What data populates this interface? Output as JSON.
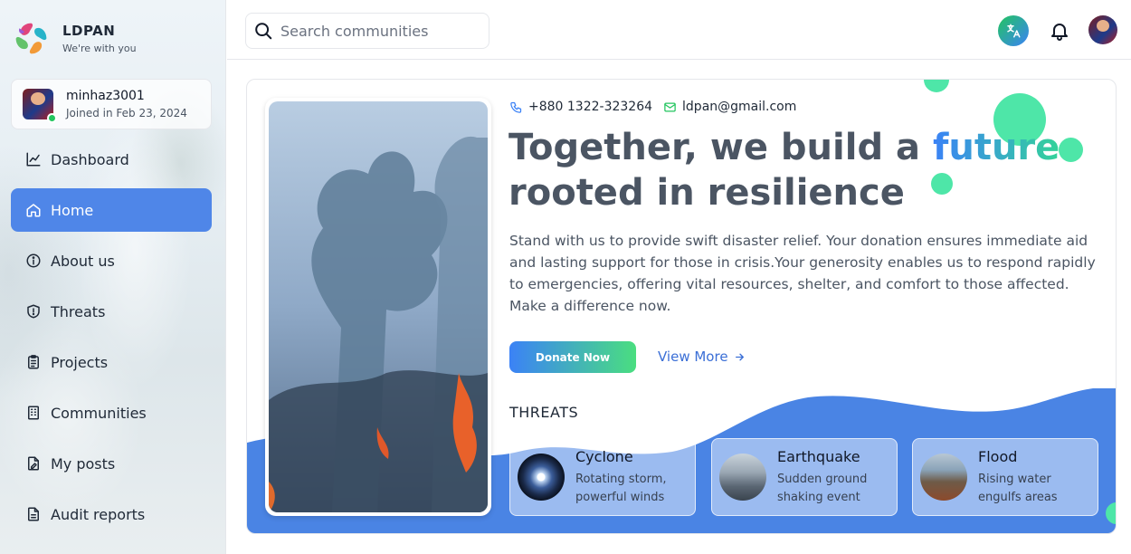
{
  "brand": {
    "name": "LDPAN",
    "tagline": "We're with you"
  },
  "user": {
    "name": "minhaz3001",
    "joined": "Joined in Feb 23, 2024",
    "status": "online"
  },
  "nav": [
    {
      "label": "Dashboard",
      "icon": "chart-line-icon",
      "active": false
    },
    {
      "label": "Home",
      "icon": "home-icon",
      "active": true
    },
    {
      "label": "About us",
      "icon": "info-icon",
      "active": false
    },
    {
      "label": "Threats",
      "icon": "shield-alert-icon",
      "active": false
    },
    {
      "label": "Projects",
      "icon": "clipboard-icon",
      "active": false
    },
    {
      "label": "Communities",
      "icon": "building-icon",
      "active": false
    },
    {
      "label": "My posts",
      "icon": "file-edit-icon",
      "active": false
    },
    {
      "label": "Audit reports",
      "icon": "document-icon",
      "active": false
    }
  ],
  "topbar": {
    "search_placeholder": "Search communities"
  },
  "hero": {
    "phone": "+880 1322-323264",
    "email": "ldpan@gmail.com",
    "headline_part1": "Together, we build a",
    "headline_accent": "future",
    "headline_part2": "rooted in resilience",
    "description": "Stand with us to provide swift disaster relief. Your donation ensures immediate aid and lasting support for those in crisis.Your generosity enables us to respond rapidly to emergencies, offering vital resources, shelter, and comfort to those affected. Make a difference now.",
    "donate_label": "Donate Now",
    "view_more_label": "View More"
  },
  "threats": {
    "label": "THREATS",
    "items": [
      {
        "title": "Cyclone",
        "desc_line1": "Rotating storm,",
        "desc_line2": "powerful winds"
      },
      {
        "title": "Earthquake",
        "desc_line1": "Sudden ground",
        "desc_line2": "shaking event"
      },
      {
        "title": "Flood",
        "desc_line1": "Rising water",
        "desc_line2": "engulfs areas"
      }
    ]
  },
  "colors": {
    "primary": "#4f86e8",
    "accent_green": "#4ee6a8",
    "wave_blue": "#4a84e4"
  }
}
